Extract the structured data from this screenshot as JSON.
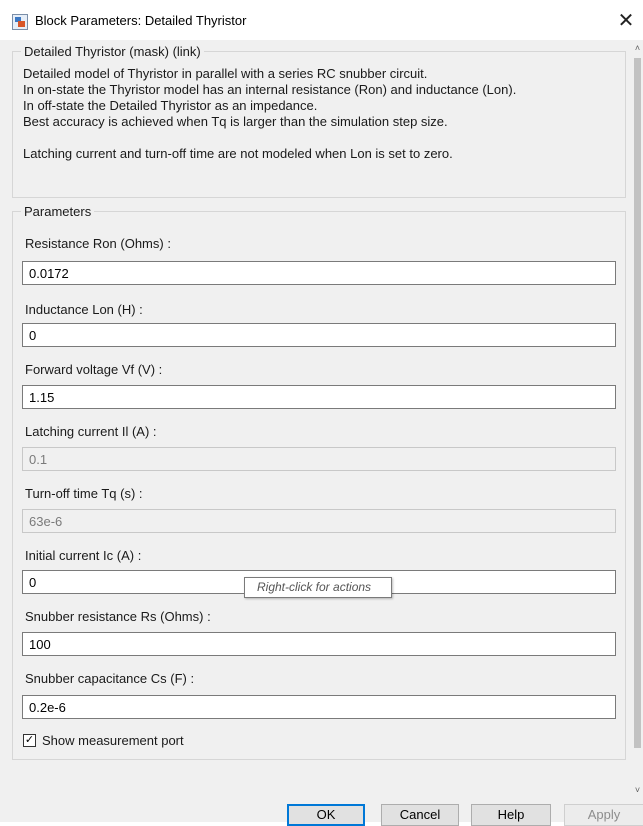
{
  "window": {
    "title": "Block Parameters: Detailed Thyristor",
    "close_glyph": "✕"
  },
  "description": {
    "group_title": "Detailed Thyristor (mask) (link)",
    "lines": [
      "Detailed model of Thyristor in parallel with a series RC snubber circuit.",
      "In on-state the Thyristor model  has an internal resistance (Ron) and inductance (Lon).",
      "In off-state the Detailed Thyristor  as an impedance.",
      "Best accuracy is achieved when Tq is larger than the simulation step size.",
      "",
      "Latching current and turn-off time are not modeled when Lon is set to zero."
    ]
  },
  "parameters": {
    "group_title": "Parameters",
    "fields": [
      {
        "label": "Resistance Ron (Ohms) :",
        "value": "0.0172",
        "enabled": true
      },
      {
        "label": "Inductance Lon (H) :",
        "value": "0",
        "enabled": true
      },
      {
        "label": "Forward voltage Vf (V) :",
        "value": "1.15",
        "enabled": true
      },
      {
        "label": "Latching current Il (A) :",
        "value": "0.1",
        "enabled": false
      },
      {
        "label": "Turn-off time Tq (s) :",
        "value": "63e-6",
        "enabled": false
      },
      {
        "label": "Initial current Ic (A) :",
        "value": "0",
        "enabled": true
      },
      {
        "label": "Snubber resistance Rs (Ohms) :",
        "value": "100",
        "enabled": true
      },
      {
        "label": "Snubber capacitance Cs (F) :",
        "value": "0.2e-6",
        "enabled": true
      }
    ],
    "show_measurement_port": {
      "label": "Show measurement port",
      "checked": true,
      "check_glyph": "✓"
    }
  },
  "tooltip": {
    "text": "Right-click for actions"
  },
  "scrollbar": {
    "up_glyph": "˄",
    "down_glyph": "˅"
  },
  "buttons": {
    "ok": "OK",
    "cancel": "Cancel",
    "help": "Help",
    "apply": "Apply"
  },
  "colors": {
    "accent": "#0078d7",
    "dialog_bg": "#f0f0f0",
    "disabled_text": "#7a7a7a"
  },
  "icons": {
    "title": "simulink-block-icon",
    "close": "close-icon",
    "check": "checkmark-icon"
  }
}
